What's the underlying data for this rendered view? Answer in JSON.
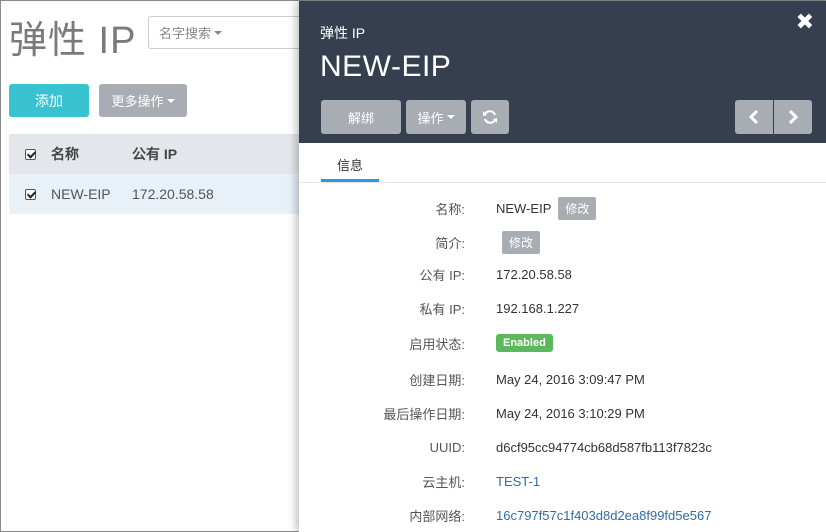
{
  "page": {
    "title": "弹性 IP",
    "search_placeholder": "名字搜索",
    "add_label": "添加",
    "more_label": "更多操作",
    "table": {
      "headers": [
        "名称",
        "公有 IP"
      ],
      "rows": [
        {
          "name": "NEW-EIP",
          "public_ip": "172.20.58.58"
        }
      ]
    }
  },
  "panel": {
    "subtitle": "弹性 IP",
    "title": "NEW-EIP",
    "close_glyph": "✖",
    "buttons": {
      "unbind": "解绑",
      "operations": "操作",
      "refresh_icon": "refresh-icon",
      "prev_icon": "chevron-left-icon",
      "next_icon": "chevron-right-icon"
    },
    "tabs": [
      "信息"
    ],
    "edit_label": "修改",
    "fields": {
      "name": {
        "label": "名称:",
        "value": "NEW-EIP"
      },
      "description": {
        "label": "简介:"
      },
      "public_ip": {
        "label": "公有 IP:",
        "value": "172.20.58.58"
      },
      "private_ip": {
        "label": "私有 IP:",
        "value": "192.168.1.227"
      },
      "state": {
        "label": "启用状态:",
        "value": "Enabled"
      },
      "created": {
        "label": "创建日期:",
        "value": "May 24, 2016 3:09:47 PM"
      },
      "modified": {
        "label": "最后操作日期:",
        "value": "May 24, 2016 3:10:29 PM"
      },
      "uuid": {
        "label": "UUID:",
        "value": "d6cf95cc94774cb68d587fb113f7823c"
      },
      "vm": {
        "label": "云主机:",
        "value": "TEST-1"
      },
      "network": {
        "label": "内部网络:",
        "value": "16c797f57c1f403d8d2ea8f99fd5e567"
      }
    }
  },
  "colors": {
    "header_bg": "#353f4f",
    "accent": "#39c3d0",
    "enabled": "#5cb85c",
    "link": "#2f6da8"
  }
}
